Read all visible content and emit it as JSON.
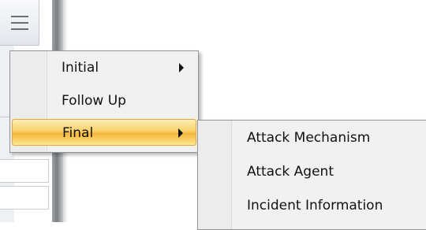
{
  "main_menu": {
    "items": [
      {
        "label": "Initial",
        "has_submenu": true,
        "selected": false
      },
      {
        "label": "Follow Up",
        "has_submenu": false,
        "selected": false
      },
      {
        "label": "Final",
        "has_submenu": true,
        "selected": true
      }
    ]
  },
  "submenu": {
    "items": [
      {
        "label": "Attack Mechanism"
      },
      {
        "label": "Attack Agent"
      },
      {
        "label": "Incident Information"
      }
    ]
  },
  "icons": {
    "menu_button": "hamburger-icon",
    "submenu_arrow": "chevron-right-icon"
  },
  "colors": {
    "highlight": "#f7c24a",
    "menu_bg": "#f1f1f1",
    "menu_border": "#959595"
  }
}
